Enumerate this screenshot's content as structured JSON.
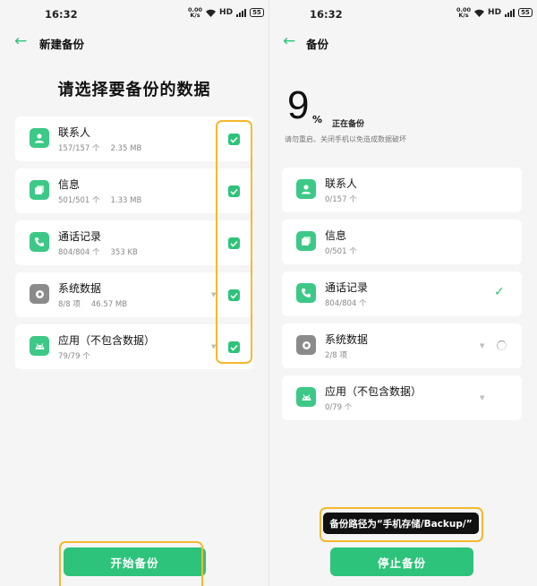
{
  "left": {
    "status": {
      "time": "16:32",
      "net_top": "0.00",
      "net_bottom": "K/s",
      "hd": "HD",
      "battery": "55"
    },
    "title": "新建备份",
    "heading": "请选择要备份的数据",
    "items": [
      {
        "name": "联系人",
        "count": "157/157 个",
        "size": "2.35 MB",
        "icon": "contact-icon",
        "checked": true
      },
      {
        "name": "信息",
        "count": "501/501 个",
        "size": "1.33 MB",
        "icon": "message-icon",
        "checked": true
      },
      {
        "name": "通话记录",
        "count": "804/804 个",
        "size": "353 KB",
        "icon": "phone-icon",
        "checked": true
      },
      {
        "name": "系统数据",
        "count": "8/8 项",
        "size": "46.57 MB",
        "icon": "gear-icon",
        "checked": true
      },
      {
        "name": "应用（不包含数据）",
        "count": "79/79 个",
        "size": "",
        "icon": "android-icon",
        "checked": true
      }
    ],
    "start_button": "开始备份"
  },
  "right": {
    "status": {
      "time": "16:32",
      "net_top": "0.00",
      "net_bottom": "K/s",
      "hd": "HD",
      "battery": "55"
    },
    "title": "备份",
    "percent": "9",
    "percent_sign": "%",
    "progress_fraction": 0.09,
    "progress_status": "正在备份",
    "warning": "请勿重启、关闭手机以免造成数据破坏",
    "items": [
      {
        "name": "联系人",
        "count": "0/157 个",
        "icon": "contact-icon",
        "state": "pending"
      },
      {
        "name": "信息",
        "count": "0/501 个",
        "icon": "message-icon",
        "state": "pending"
      },
      {
        "name": "通话记录",
        "count": "804/804 个",
        "icon": "phone-icon",
        "state": "done"
      },
      {
        "name": "系统数据",
        "count": "2/8 项",
        "icon": "gear-icon",
        "state": "in-progress"
      },
      {
        "name": "应用（不包含数据）",
        "count": "0/79 个",
        "icon": "android-icon",
        "state": "pending"
      }
    ],
    "toast": "备份路径为“手机存储/Backup/”",
    "stop_button": "停止备份"
  },
  "colors": {
    "accent": "#2ec37a",
    "highlight": "#f5b82e",
    "icon_green": "#3dc887",
    "icon_gray": "#8b8b8b"
  }
}
